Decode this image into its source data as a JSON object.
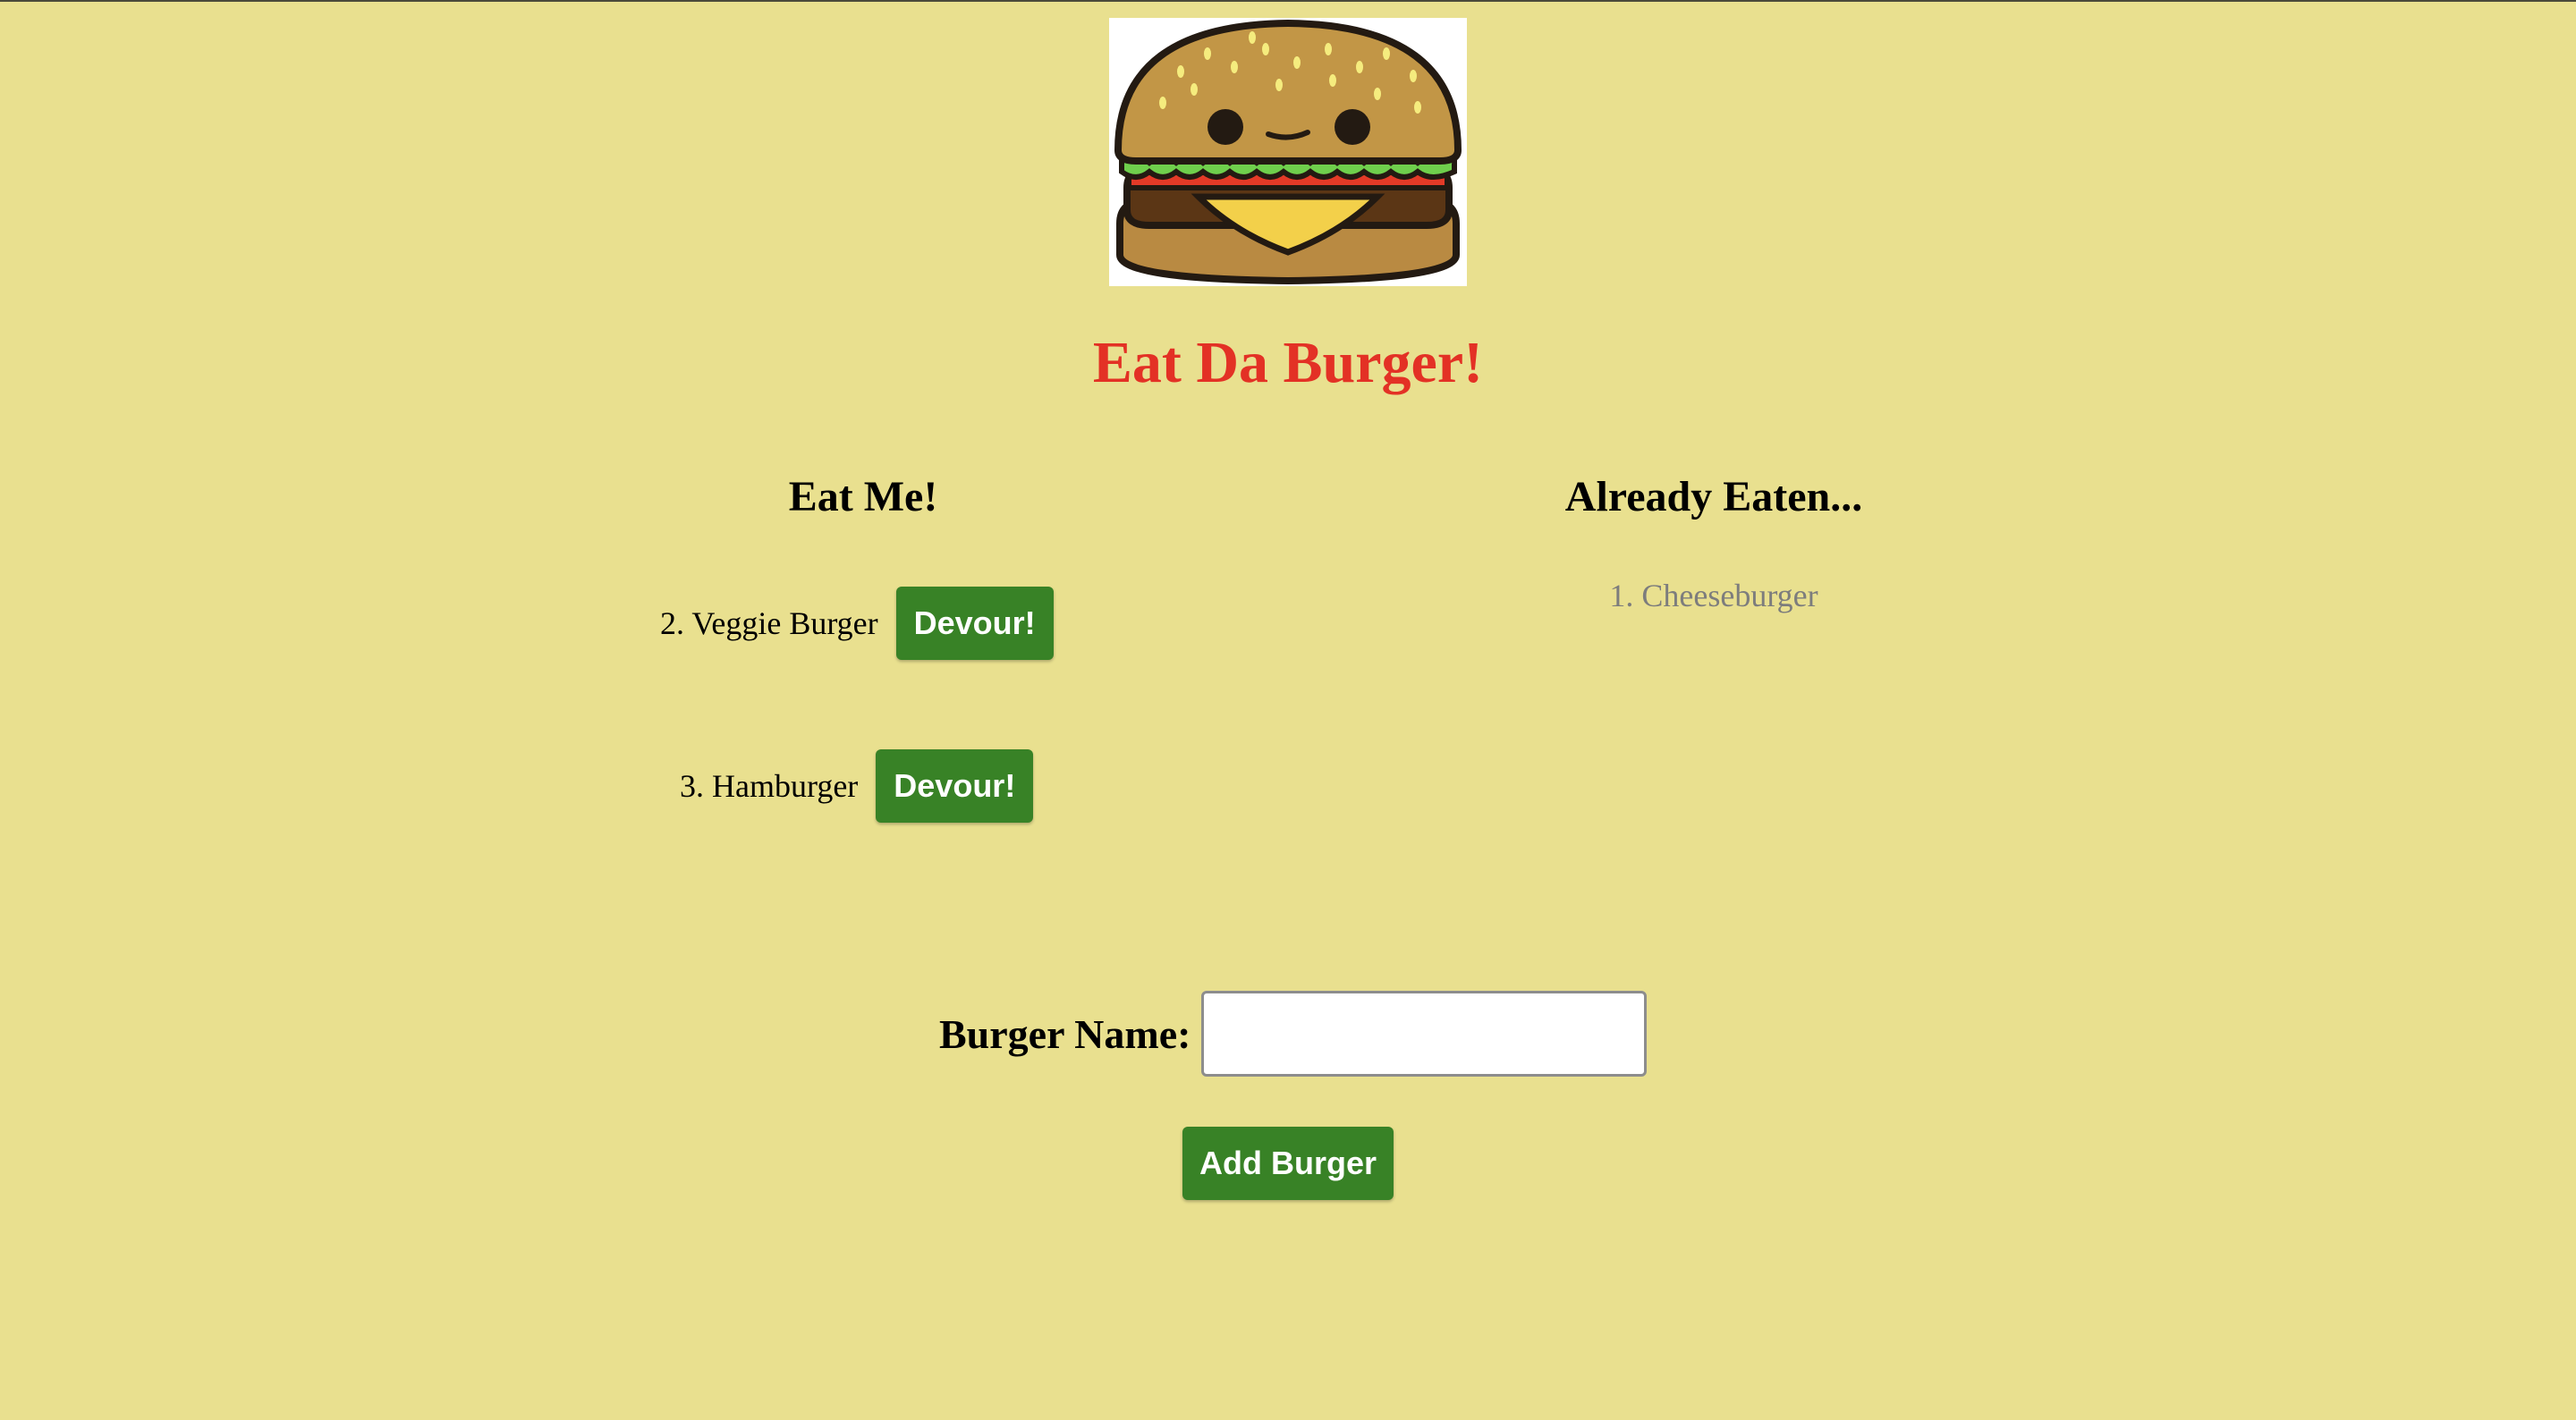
{
  "logo": {
    "alt": "burger-logo"
  },
  "title": "Eat Da Burger!",
  "columns": {
    "uneaten_heading": "Eat Me!",
    "eaten_heading": "Already Eaten..."
  },
  "uneaten": [
    {
      "label": "2. Veggie Burger",
      "button": "Devour!"
    },
    {
      "label": "3. Hamburger",
      "button": "Devour!"
    }
  ],
  "eaten": [
    {
      "label": "1. Cheeseburger"
    }
  ],
  "form": {
    "label": "Burger Name:",
    "input_value": "",
    "submit_label": "Add Burger"
  },
  "colors": {
    "background": "#e9e08f",
    "title": "#e33125",
    "button": "#388226",
    "eaten_text": "#7d7d7d"
  }
}
